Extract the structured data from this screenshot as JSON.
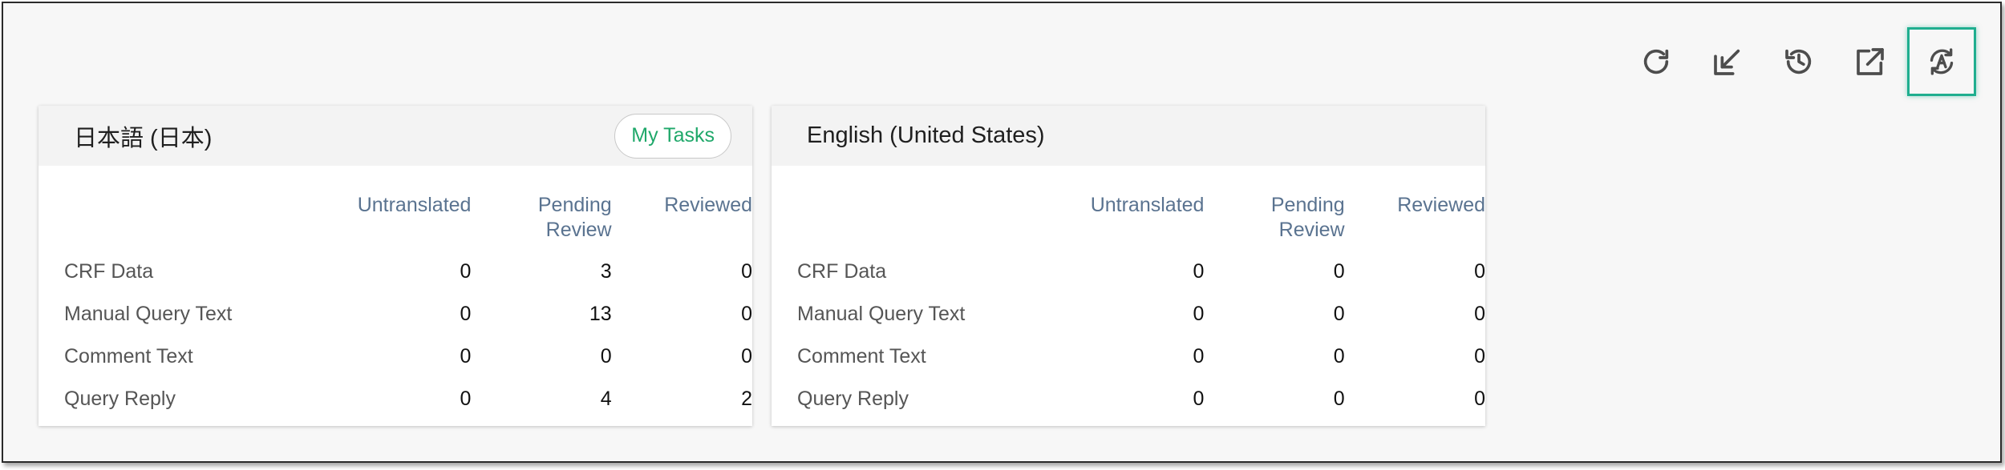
{
  "toolbar": {
    "icons": [
      "refresh-icon",
      "import-icon",
      "history-icon",
      "open-external-icon",
      "auto-translate-icon"
    ],
    "active_icon": "auto-translate-icon"
  },
  "colors": {
    "accent": "#1fae8f",
    "my_tasks_text": "#1fa86a",
    "header_text": "#5a7390"
  },
  "columns": [
    "Untranslated",
    "Pending Review",
    "Reviewed"
  ],
  "cards": [
    {
      "title": "日本語 (日本)",
      "my_tasks_label": "My Tasks",
      "rows": [
        {
          "label": "CRF Data",
          "untranslated": "0",
          "pending_review": "3",
          "reviewed": "0"
        },
        {
          "label": "Manual Query Text",
          "untranslated": "0",
          "pending_review": "13",
          "reviewed": "0"
        },
        {
          "label": "Comment Text",
          "untranslated": "0",
          "pending_review": "0",
          "reviewed": "0"
        },
        {
          "label": "Query Reply",
          "untranslated": "0",
          "pending_review": "4",
          "reviewed": "2"
        }
      ]
    },
    {
      "title": "English (United States)",
      "rows": [
        {
          "label": "CRF Data",
          "untranslated": "0",
          "pending_review": "0",
          "reviewed": "0"
        },
        {
          "label": "Manual Query Text",
          "untranslated": "0",
          "pending_review": "0",
          "reviewed": "0"
        },
        {
          "label": "Comment Text",
          "untranslated": "0",
          "pending_review": "0",
          "reviewed": "0"
        },
        {
          "label": "Query Reply",
          "untranslated": "0",
          "pending_review": "0",
          "reviewed": "0"
        }
      ]
    }
  ]
}
